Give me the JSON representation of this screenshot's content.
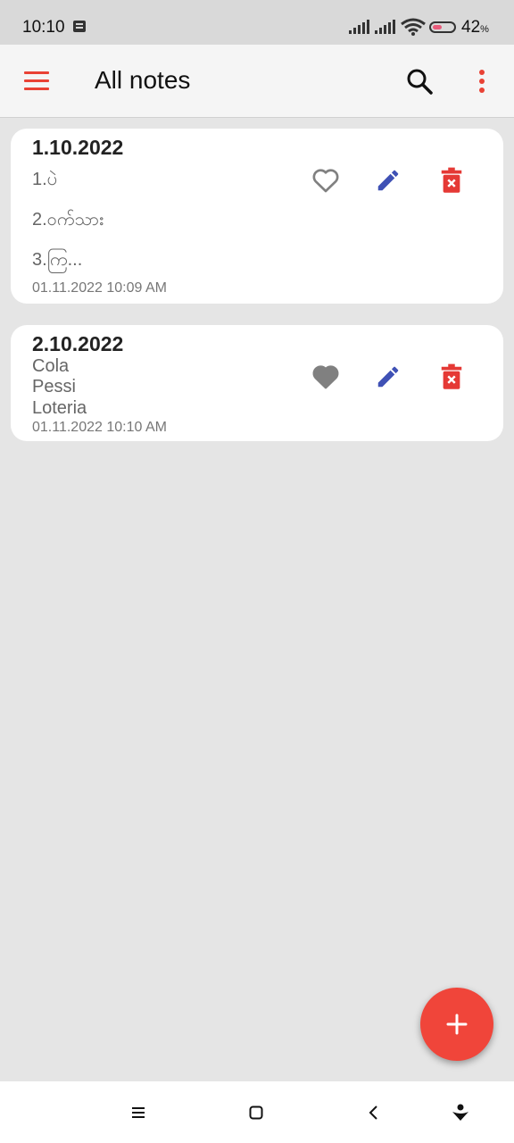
{
  "status_bar": {
    "time": "10:10",
    "battery_pct": "42",
    "battery_unit": "%",
    "battery_level": 0.42,
    "icons": [
      "message-icon",
      "signal-icon",
      "signal-icon",
      "wifi-icon",
      "battery-icon"
    ]
  },
  "app_bar": {
    "title": "All notes",
    "menu_icon": "hamburger-menu-icon",
    "search_icon": "search-icon",
    "more_icon": "more-vert-icon",
    "accent": "#e94235"
  },
  "notes": [
    {
      "title": "1.10.2022",
      "lines": [
        "1.ပဲ",
        "2.ဝက်သား",
        "3.ကြ..."
      ],
      "date": "01.11.2022 10:09 AM",
      "favorite": false
    },
    {
      "title": "2.10.2022",
      "lines": [
        "Cola",
        "Pessi",
        "Loteria"
      ],
      "date": "01.11.2022 10:10 AM",
      "favorite": true
    }
  ],
  "actions": {
    "favorite_icon": "heart-icon",
    "edit_icon": "pencil-icon",
    "delete_icon": "trash-icon",
    "edit_color": "#3f51b5",
    "delete_color": "#e53935",
    "favorite_color": "#808080"
  },
  "fab": {
    "icon": "plus-icon",
    "color": "#f0453a"
  },
  "nav_bar": {
    "icons": [
      "recents-icon",
      "home-icon",
      "back-icon",
      "assistant-icon"
    ]
  }
}
